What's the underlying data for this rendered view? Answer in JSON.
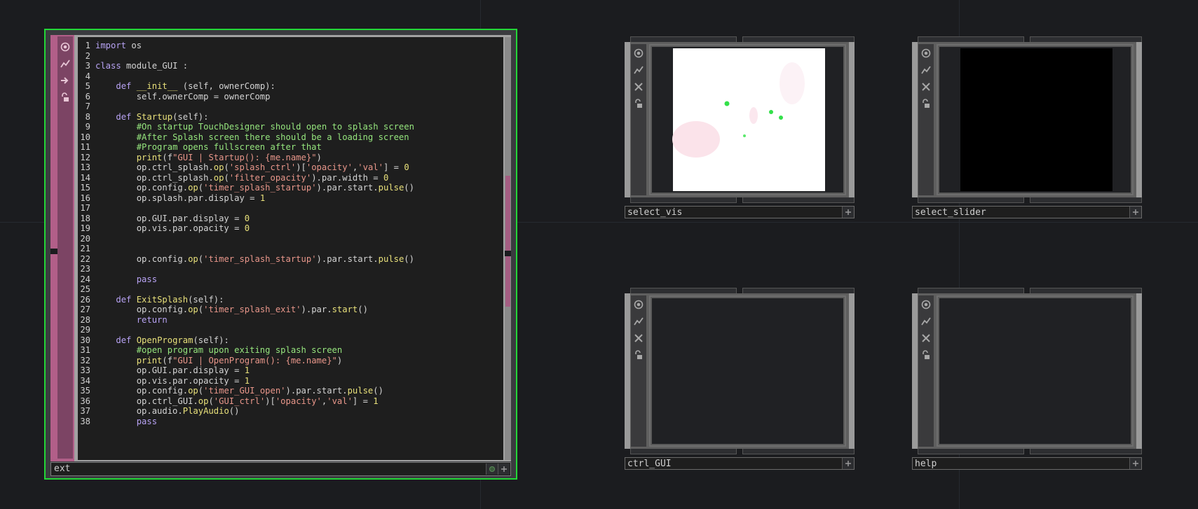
{
  "dat_node": {
    "label": "ext",
    "code_lines": [
      {
        "n": "1",
        "segs": [
          [
            "kw",
            "import"
          ],
          [
            "",
            "os"
          ]
        ]
      },
      {
        "n": "2",
        "segs": []
      },
      {
        "n": "3",
        "segs": [
          [
            "kw",
            "class"
          ],
          [
            "cls",
            "module_GUI :"
          ]
        ]
      },
      {
        "n": "4",
        "segs": []
      },
      {
        "n": "5",
        "segs": [
          [
            "",
            "    "
          ],
          [
            "kw",
            "def"
          ],
          [
            "fn",
            "__init__"
          ],
          [
            "",
            " (self, ownerComp):"
          ]
        ]
      },
      {
        "n": "6",
        "segs": [
          [
            "",
            "        self.ownerComp = ownerComp"
          ]
        ]
      },
      {
        "n": "7",
        "segs": []
      },
      {
        "n": "8",
        "segs": [
          [
            "",
            "    "
          ],
          [
            "kw",
            "def"
          ],
          [
            "fn",
            "Startup"
          ],
          [
            "",
            "(self):"
          ]
        ]
      },
      {
        "n": "9",
        "segs": [
          [
            "",
            "        "
          ],
          [
            "cm",
            "#On startup TouchDesigner should open to splash screen"
          ]
        ]
      },
      {
        "n": "10",
        "segs": [
          [
            "",
            "        "
          ],
          [
            "cm",
            "#After Splash screen there should be a loading screen"
          ]
        ]
      },
      {
        "n": "11",
        "segs": [
          [
            "",
            "        "
          ],
          [
            "cm",
            "#Program opens fullscreen after that"
          ]
        ]
      },
      {
        "n": "12",
        "segs": [
          [
            "",
            "        "
          ],
          [
            "fn",
            "print"
          ],
          [
            "",
            "(f"
          ],
          [
            "str",
            "\"GUI | Startup(): {me.name}\""
          ],
          [
            "",
            ")"
          ]
        ]
      },
      {
        "n": "13",
        "segs": [
          [
            "",
            "        op.ctrl_splash."
          ],
          [
            "fn",
            "op"
          ],
          [
            "",
            "("
          ],
          [
            "str",
            "'splash_ctrl'"
          ],
          [
            "",
            ")["
          ],
          [
            "str",
            "'opacity'"
          ],
          [
            "",
            ","
          ],
          [
            "str",
            "'val'"
          ],
          [
            "",
            "] = "
          ],
          [
            "num",
            "0"
          ]
        ]
      },
      {
        "n": "14",
        "segs": [
          [
            "",
            "        op.ctrl_splash."
          ],
          [
            "fn",
            "op"
          ],
          [
            "",
            "("
          ],
          [
            "str",
            "'filter_opacity'"
          ],
          [
            "",
            ").par.width = "
          ],
          [
            "num",
            "0"
          ]
        ]
      },
      {
        "n": "15",
        "segs": [
          [
            "",
            "        op.config."
          ],
          [
            "fn",
            "op"
          ],
          [
            "",
            "("
          ],
          [
            "str",
            "'timer_splash_startup'"
          ],
          [
            "",
            ").par.start."
          ],
          [
            "fn",
            "pulse"
          ],
          [
            "",
            "()"
          ]
        ]
      },
      {
        "n": "16",
        "segs": [
          [
            "",
            "        op.splash.par.display = "
          ],
          [
            "num",
            "1"
          ]
        ]
      },
      {
        "n": "17",
        "segs": []
      },
      {
        "n": "18",
        "segs": [
          [
            "",
            "        op.GUI.par.display = "
          ],
          [
            "num",
            "0"
          ]
        ]
      },
      {
        "n": "19",
        "segs": [
          [
            "",
            "        op.vis.par.opacity = "
          ],
          [
            "num",
            "0"
          ]
        ]
      },
      {
        "n": "20",
        "segs": []
      },
      {
        "n": "21",
        "segs": []
      },
      {
        "n": "22",
        "segs": [
          [
            "",
            "        op.config."
          ],
          [
            "fn",
            "op"
          ],
          [
            "",
            "("
          ],
          [
            "str",
            "'timer_splash_startup'"
          ],
          [
            "",
            ").par.start."
          ],
          [
            "fn",
            "pulse"
          ],
          [
            "",
            "()"
          ]
        ]
      },
      {
        "n": "23",
        "segs": []
      },
      {
        "n": "24",
        "segs": [
          [
            "",
            "        "
          ],
          [
            "kw",
            "pass"
          ]
        ]
      },
      {
        "n": "25",
        "segs": []
      },
      {
        "n": "26",
        "segs": [
          [
            "",
            "    "
          ],
          [
            "kw",
            "def"
          ],
          [
            "fn",
            "ExitSplash"
          ],
          [
            "",
            "(self):"
          ]
        ]
      },
      {
        "n": "27",
        "segs": [
          [
            "",
            "        op.config."
          ],
          [
            "fn",
            "op"
          ],
          [
            "",
            "("
          ],
          [
            "str",
            "'timer_splash_exit'"
          ],
          [
            "",
            ").par."
          ],
          [
            "fn",
            "start"
          ],
          [
            "",
            "()"
          ]
        ]
      },
      {
        "n": "28",
        "segs": [
          [
            "",
            "        "
          ],
          [
            "kw",
            "return"
          ]
        ]
      },
      {
        "n": "29",
        "segs": []
      },
      {
        "n": "30",
        "segs": [
          [
            "",
            "    "
          ],
          [
            "kw",
            "def"
          ],
          [
            "fn",
            "OpenProgram"
          ],
          [
            "",
            "(self):"
          ]
        ]
      },
      {
        "n": "31",
        "segs": [
          [
            "",
            "        "
          ],
          [
            "cm",
            "#open program upon exiting splash screen"
          ]
        ]
      },
      {
        "n": "32",
        "segs": [
          [
            "",
            "        "
          ],
          [
            "fn",
            "print"
          ],
          [
            "",
            "(f"
          ],
          [
            "str",
            "\"GUI | OpenProgram(): {me.name}\""
          ],
          [
            "",
            ")"
          ]
        ]
      },
      {
        "n": "33",
        "segs": [
          [
            "",
            "        op.GUI.par.display = "
          ],
          [
            "num",
            "1"
          ]
        ]
      },
      {
        "n": "34",
        "segs": [
          [
            "",
            "        op.vis.par.opacity = "
          ],
          [
            "num",
            "1"
          ]
        ]
      },
      {
        "n": "35",
        "segs": [
          [
            "",
            "        op.config."
          ],
          [
            "fn",
            "op"
          ],
          [
            "",
            "("
          ],
          [
            "str",
            "'timer_GUI_open'"
          ],
          [
            "",
            ").par.start."
          ],
          [
            "fn",
            "pulse"
          ],
          [
            "",
            "()"
          ]
        ]
      },
      {
        "n": "36",
        "segs": [
          [
            "",
            "        op.ctrl_GUI."
          ],
          [
            "fn",
            "op"
          ],
          [
            "",
            "("
          ],
          [
            "str",
            "'GUI_ctrl'"
          ],
          [
            "",
            ")["
          ],
          [
            "str",
            "'opacity'"
          ],
          [
            "",
            ","
          ],
          [
            "str",
            "'val'"
          ],
          [
            "",
            "] = "
          ],
          [
            "num",
            "1"
          ]
        ]
      },
      {
        "n": "37",
        "segs": [
          [
            "",
            "        op.audio."
          ],
          [
            "fn",
            "PlayAudio"
          ],
          [
            "",
            "()"
          ]
        ]
      },
      {
        "n": "38",
        "segs": [
          [
            "",
            "        "
          ],
          [
            "kw",
            "pass"
          ]
        ]
      }
    ]
  },
  "comp_nodes": [
    {
      "label": "select_vis",
      "viewer": "white"
    },
    {
      "label": "select_slider",
      "viewer": "black"
    },
    {
      "label": "ctrl_GUI",
      "viewer": "empty"
    },
    {
      "label": "help",
      "viewer": "empty"
    }
  ],
  "colors": {
    "selected_outline": "#23d637",
    "dat_accent": "#b25f89"
  },
  "icons": [
    "viewer-icon",
    "bypass-icon",
    "cook-icon",
    "lock-icon",
    "close-icon",
    "add-icon"
  ]
}
